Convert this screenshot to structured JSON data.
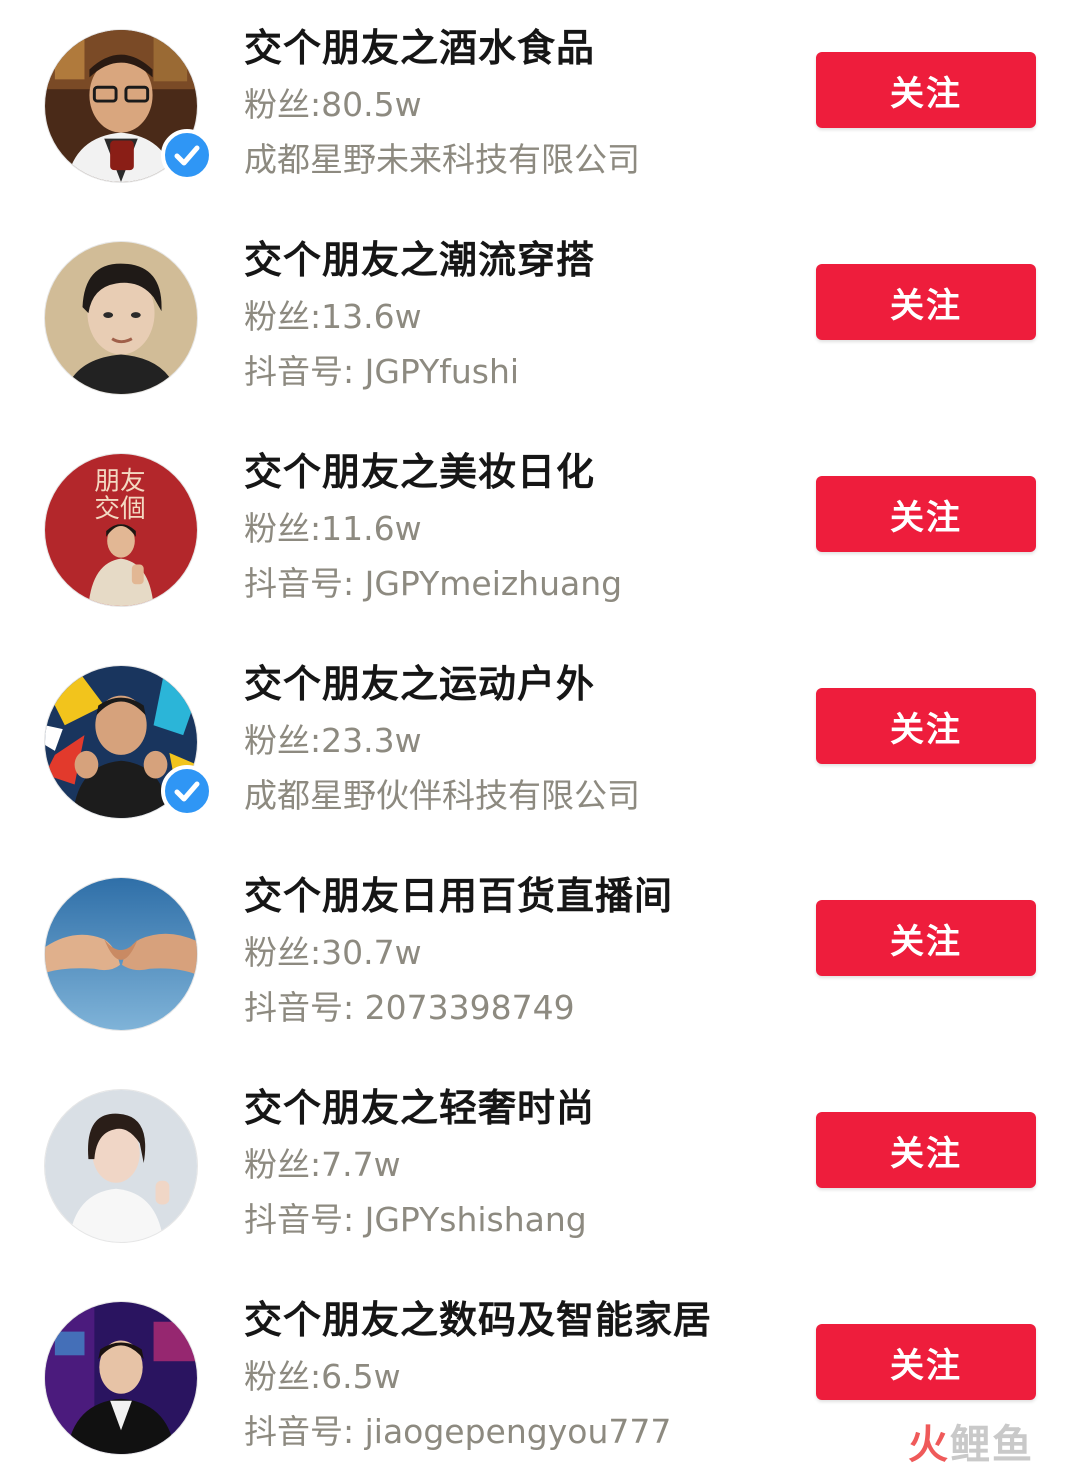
{
  "follow_label": "关注",
  "accounts": [
    {
      "name": "交个朋友之酒水食品",
      "fans": "粉丝:80.5w",
      "sub": "成都星野未来科技有限公司",
      "verified": true
    },
    {
      "name": "交个朋友之潮流穿搭",
      "fans": "粉丝:13.6w",
      "sub": "抖音号: JGPYfushi",
      "verified": false
    },
    {
      "name": "交个朋友之美妆日化",
      "fans": "粉丝:11.6w",
      "sub": "抖音号: JGPYmeizhuang",
      "verified": false,
      "avatar_text": "朋友 交個"
    },
    {
      "name": "交个朋友之运动户外",
      "fans": "粉丝:23.3w",
      "sub": "成都星野伙伴科技有限公司",
      "verified": true
    },
    {
      "name": "交个朋友日用百货直播间",
      "fans": "粉丝:30.7w",
      "sub": "抖音号: 2073398749",
      "verified": false
    },
    {
      "name": "交个朋友之轻奢时尚",
      "fans": "粉丝:7.7w",
      "sub": "抖音号: JGPYshishang",
      "verified": false
    },
    {
      "name": "交个朋友之数码及智能家居",
      "fans": "粉丝:6.5w",
      "sub": "抖音号: jiaogepengyou777",
      "verified": false
    }
  ],
  "watermark": {
    "part1": "火",
    "part2": "鲤鱼"
  },
  "colors": {
    "follow_button": "#ee1d3c",
    "verified_badge": "#2f96f5",
    "name_text": "#161616",
    "meta_text": "#8d8a80"
  },
  "icons": {
    "verified": "check-icon"
  }
}
